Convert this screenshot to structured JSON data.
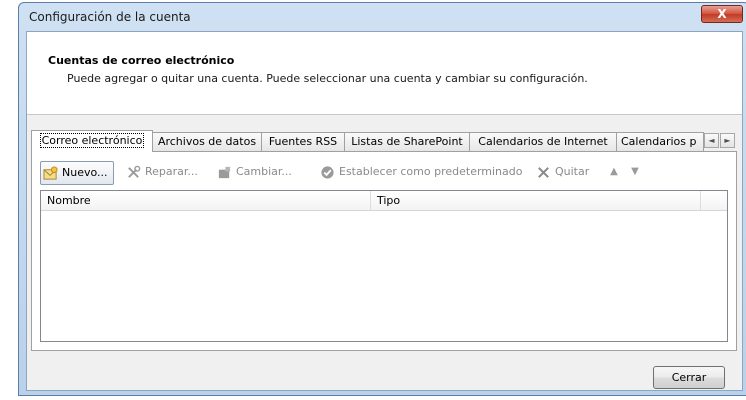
{
  "window": {
    "title": "Configuración de la cuenta",
    "close_glyph": "X"
  },
  "header": {
    "title": "Cuentas de correo electrónico",
    "description": "Puede agregar o quitar una cuenta. Puede seleccionar una cuenta y cambiar su configuración."
  },
  "tabs": [
    {
      "label": "Correo electrónico",
      "active": true
    },
    {
      "label": "Archivos de datos",
      "active": false
    },
    {
      "label": "Fuentes RSS",
      "active": false
    },
    {
      "label": "Listas de SharePoint",
      "active": false
    },
    {
      "label": "Calendarios de Internet",
      "active": false
    },
    {
      "label": "Calendarios p",
      "active": false
    }
  ],
  "tab_scroll": {
    "left": "◄",
    "right": "►"
  },
  "toolbar": {
    "new_label": "Nuevo...",
    "repair_label": "Reparar...",
    "change_label": "Cambiar...",
    "default_label": "Establecer como predeterminado",
    "remove_label": "Quitar",
    "up_glyph": "▲",
    "down_glyph": "▼"
  },
  "list": {
    "columns": [
      "Nombre",
      "Tipo"
    ],
    "rows": []
  },
  "footer": {
    "close_label": "Cerrar"
  },
  "colors": {
    "title_gradient_top": "#cfe1f3",
    "close_red": "#c13a24"
  }
}
